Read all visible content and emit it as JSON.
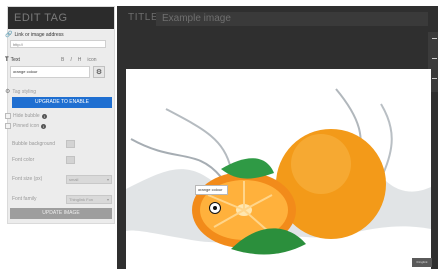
{
  "panel": {
    "header": "EDIT TAG",
    "link_label": "Link or image address",
    "link_placeholder": "http://",
    "text_label": "Text",
    "text_controls": [
      "B",
      "I",
      "H",
      "icon"
    ],
    "text_value": "orange colour",
    "tag_styling": "Tag styling",
    "upgrade_button": "UPGRADE TO ENABLE",
    "hide_bubble": "Hide bubble",
    "pinned_icon": "Pinned icon",
    "bubble_background": "Bubble background",
    "font_color": "Font color",
    "font_size_label": "Font size (px)",
    "font_size_value": "small",
    "font_family_label": "Font family",
    "font_family_value": "Thinglink Fon",
    "update_button": "UPDATE IMAGE"
  },
  "editor": {
    "title_label": "TITLE",
    "title_value": "Example image",
    "tag_tooltip": "orange colour",
    "badge": "thinglink"
  },
  "colors": {
    "accent": "#1f6fd1",
    "dark_bg": "#2f2f2f",
    "panel_bg": "#ececec"
  }
}
